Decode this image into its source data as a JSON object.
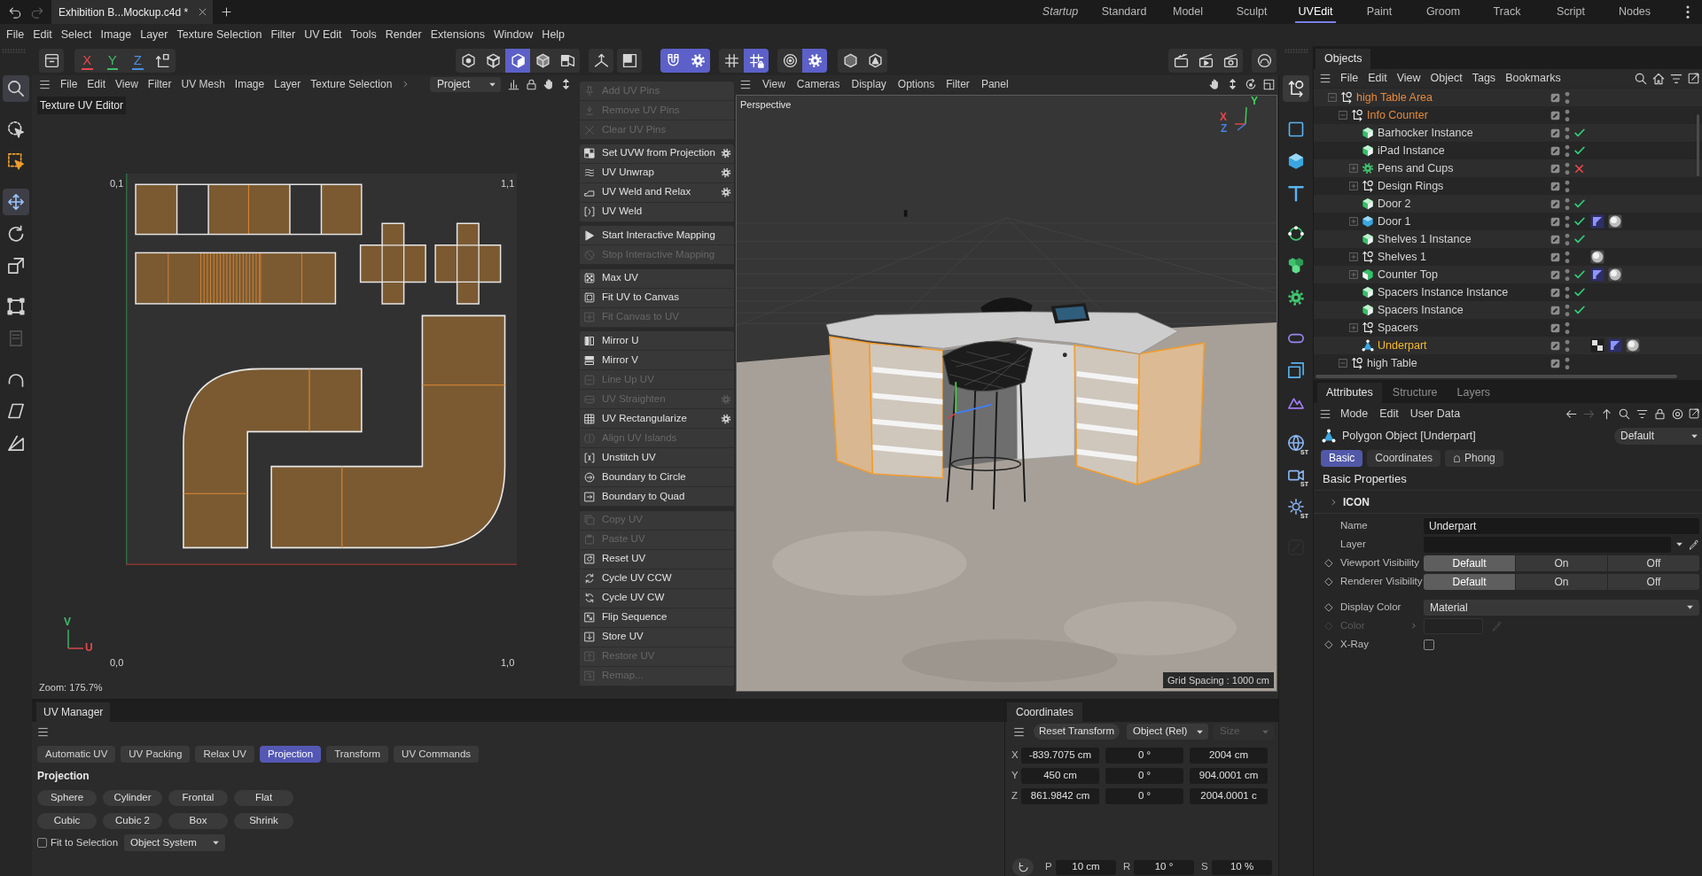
{
  "title_bar": {
    "document_tab": "Exhibition B...Mockup.c4d *",
    "layouts": [
      {
        "label": "Startup",
        "kind": "startup",
        "selected": false
      },
      {
        "label": "Standard",
        "kind": "layout",
        "selected": false
      },
      {
        "label": "Model",
        "kind": "layout",
        "selected": false
      },
      {
        "label": "Sculpt",
        "kind": "layout",
        "selected": false
      },
      {
        "label": "UVEdit",
        "kind": "layout",
        "selected": true
      },
      {
        "label": "Paint",
        "kind": "layout",
        "selected": false
      },
      {
        "label": "Groom",
        "kind": "layout",
        "selected": false
      },
      {
        "label": "Track",
        "kind": "layout",
        "selected": false
      },
      {
        "label": "Script",
        "kind": "layout",
        "selected": false
      },
      {
        "label": "Nodes",
        "kind": "layout",
        "selected": false
      }
    ]
  },
  "menu": [
    "File",
    "Edit",
    "Select",
    "Image",
    "Layer",
    "Texture Selection",
    "Filter",
    "UV Edit",
    "Tools",
    "Render",
    "Extensions",
    "Window",
    "Help"
  ],
  "toolbar": {
    "axis_locks": [
      {
        "label": "X",
        "on": true,
        "color": "#e5484d"
      },
      {
        "label": "Y",
        "on": true,
        "color": "#3dbd6b"
      },
      {
        "label": "Z",
        "on": true,
        "color": "#4a90e2"
      }
    ],
    "groups": [
      [
        {
          "active": false
        }
      ],
      [
        {
          "active": false
        },
        {
          "active": false
        },
        {
          "active": true
        },
        {
          "active": false
        },
        {
          "active": false
        }
      ],
      [
        {
          "active": false
        }
      ],
      [
        {
          "active": false
        }
      ],
      [
        {
          "active": true
        },
        {
          "active": true
        }
      ],
      [
        {
          "active": false
        },
        {
          "active": true
        }
      ],
      [
        {
          "active": false
        },
        {
          "active": true
        }
      ],
      [
        {
          "active": false
        },
        {
          "active": false
        }
      ],
      [
        {
          "active": false
        },
        {
          "active": false
        },
        {
          "active": false
        }
      ],
      [
        {
          "active": false
        }
      ]
    ]
  },
  "left_tools": [
    [
      {
        "active": true,
        "disabled": false
      }
    ],
    [
      {
        "active": false,
        "disabled": false
      },
      {
        "active": false,
        "disabled": false
      }
    ],
    [
      {
        "active": true,
        "disabled": false
      },
      {
        "active": false,
        "disabled": false
      },
      {
        "active": false,
        "disabled": false
      }
    ],
    [
      {
        "active": false,
        "disabled": false
      },
      {
        "active": false,
        "disabled": true
      }
    ],
    [
      {
        "active": false,
        "disabled": false
      },
      {
        "active": false,
        "disabled": false
      },
      {
        "active": false,
        "disabled": false
      }
    ]
  ],
  "uv_editor": {
    "menu": [
      "File",
      "Edit",
      "View",
      "Filter",
      "UV Mesh",
      "Image",
      "Layer",
      "Texture Selection"
    ],
    "mode": "Project",
    "title": "Texture UV Editor",
    "corner_labels": [
      "0,1",
      "1,1",
      "0,0",
      "1,0"
    ],
    "axis_labels": [
      {
        "label": "V",
        "color": "#3dbd6b"
      },
      {
        "label": "U",
        "color": "#e5484d"
      }
    ],
    "zoom": "Zoom: 175.7%"
  },
  "uv_commands": [
    [
      {
        "label": "Add UV Pins",
        "disabled": true,
        "options": false
      },
      {
        "label": "Remove UV Pins",
        "disabled": true,
        "options": false
      },
      {
        "label": "Clear UV Pins",
        "disabled": true,
        "options": false
      }
    ],
    [
      {
        "label": "Set UVW from Projection",
        "disabled": false,
        "options": true
      },
      {
        "label": "UV Unwrap",
        "disabled": false,
        "options": true
      },
      {
        "label": "UV Weld and Relax",
        "disabled": false,
        "options": true
      },
      {
        "label": "UV Weld",
        "disabled": false,
        "options": false
      }
    ],
    [
      {
        "label": "Start Interactive Mapping",
        "disabled": false,
        "options": false
      },
      {
        "label": "Stop Interactive Mapping",
        "disabled": true,
        "options": false
      }
    ],
    [
      {
        "label": "Max UV",
        "disabled": false,
        "options": false
      },
      {
        "label": "Fit UV to Canvas",
        "disabled": false,
        "options": false
      },
      {
        "label": "Fit Canvas to UV",
        "disabled": true,
        "options": false
      }
    ],
    [
      {
        "label": "Mirror U",
        "disabled": false,
        "options": false
      },
      {
        "label": "Mirror V",
        "disabled": false,
        "options": false
      },
      {
        "label": "Line Up UV",
        "disabled": true,
        "options": false
      },
      {
        "label": "UV Straighten",
        "disabled": true,
        "options": true
      },
      {
        "label": "UV Rectangularize",
        "disabled": false,
        "options": true
      },
      {
        "label": "Align UV Islands",
        "disabled": true,
        "options": false
      },
      {
        "label": "Unstitch UV",
        "disabled": false,
        "options": false
      },
      {
        "label": "Boundary to Circle",
        "disabled": false,
        "options": false
      },
      {
        "label": "Boundary to Quad",
        "disabled": false,
        "options": false
      }
    ],
    [
      {
        "label": "Copy UV",
        "disabled": true,
        "options": false
      },
      {
        "label": "Paste UV",
        "disabled": true,
        "options": false
      },
      {
        "label": "Reset UV",
        "disabled": false,
        "options": false
      },
      {
        "label": "Cycle UV CCW",
        "disabled": false,
        "options": false
      },
      {
        "label": "Cycle UV CW",
        "disabled": false,
        "options": false
      },
      {
        "label": "Flip Sequence",
        "disabled": false,
        "options": false
      },
      {
        "label": "Store UV",
        "disabled": false,
        "options": false
      },
      {
        "label": "Restore UV",
        "disabled": true,
        "options": false
      },
      {
        "label": "Remap...",
        "disabled": true,
        "options": false
      }
    ]
  ],
  "viewport": {
    "menu": [
      "View",
      "Cameras",
      "Display",
      "Options",
      "Filter",
      "Panel"
    ],
    "camera": "Perspective",
    "axes": [
      {
        "label": "Y",
        "color": "#3dd65a"
      },
      {
        "label": "X",
        "color": "#e5484d"
      },
      {
        "label": "Z",
        "color": "#4a7fe2"
      }
    ],
    "grid_spacing": "Grid Spacing : 1000 cm"
  },
  "uv_manager": {
    "tab": "UV Manager",
    "tabs": [
      {
        "label": "Automatic UV",
        "selected": false
      },
      {
        "label": "UV Packing",
        "selected": false
      },
      {
        "label": "Relax UV",
        "selected": false
      },
      {
        "label": "Projection",
        "selected": true
      },
      {
        "label": "Transform",
        "selected": false
      },
      {
        "label": "UV Commands",
        "selected": false
      }
    ],
    "section": "Projection",
    "buttons": [
      "Sphere",
      "Cylinder",
      "Frontal",
      "Flat",
      "Cubic",
      "Cubic 2",
      "Box",
      "Shrink"
    ],
    "fit_to_selection": {
      "label": "Fit to Selection",
      "checked": false
    },
    "system": "Object System"
  },
  "coordinates": {
    "tab": "Coordinates",
    "reset": "Reset Transform",
    "mode": "Object (Rel)",
    "size": {
      "label": "Size",
      "disabled": true
    },
    "rows": [
      {
        "axis": "X",
        "values": [
          "-839.7075 cm",
          "0 °",
          "2004 cm"
        ]
      },
      {
        "axis": "Y",
        "values": [
          "450 cm",
          "0 °",
          "904.0001 cm"
        ]
      },
      {
        "axis": "Z",
        "values": [
          "861.9842 cm",
          "0 °",
          "2004.0001 c"
        ]
      }
    ],
    "steps": [
      {
        "label": "P",
        "value": "10 cm"
      },
      {
        "label": "R",
        "value": "10 °"
      },
      {
        "label": "S",
        "value": "10 %"
      }
    ]
  },
  "right_tools": [
    [
      {
        "active": true,
        "disabled": false
      }
    ],
    [
      {
        "active": false,
        "disabled": false
      },
      {
        "active": false,
        "disabled": false
      },
      {
        "active": false,
        "disabled": false
      }
    ],
    [
      {
        "active": false,
        "disabled": false
      },
      {
        "active": false,
        "disabled": false
      },
      {
        "active": false,
        "disabled": false
      }
    ],
    [
      {
        "active": false,
        "disabled": false
      },
      {
        "active": false,
        "disabled": false
      },
      {
        "active": false,
        "disabled": false
      }
    ],
    [
      {
        "active": false,
        "disabled": false,
        "badge": "ST"
      },
      {
        "active": false,
        "disabled": false,
        "badge": "ST"
      },
      {
        "active": false,
        "disabled": false,
        "badge": "ST"
      }
    ],
    [
      {
        "active": false,
        "disabled": true
      }
    ]
  ],
  "objects": {
    "tab": "Objects",
    "menu": [
      "File",
      "Edit",
      "View",
      "Object",
      "Tags",
      "Bookmarks"
    ],
    "tree": [
      {
        "name": "high Table Area",
        "kind": "null",
        "selected": false,
        "expanded": true,
        "children": [
          {
            "name": "Info Counter",
            "kind": "null",
            "selected": false,
            "expanded": true,
            "children": [
              {
                "name": "Barhocker Instance",
                "kind": "instance",
                "selected": false,
                "enabled": true
              },
              {
                "name": "iPad Instance",
                "kind": "instance",
                "selected": false,
                "enabled": true
              },
              {
                "name": "Pens and Cups",
                "kind": "generator",
                "selected": false,
                "expanded": false,
                "enabled": false
              },
              {
                "name": "Design Rings",
                "kind": "null",
                "selected": false,
                "expanded": false
              },
              {
                "name": "Door 2",
                "kind": "instance",
                "selected": false,
                "enabled": true
              },
              {
                "name": "Door 1",
                "kind": "primitive",
                "selected": false,
                "expanded": false,
                "enabled": true,
                "tags": [
                  {
                    "kind": "phong"
                  },
                  {
                    "kind": "material"
                  }
                ]
              },
              {
                "name": "Shelves 1 Instance",
                "kind": "instance",
                "selected": false,
                "enabled": true
              },
              {
                "name": "Shelves 1",
                "kind": "null",
                "selected": false,
                "expanded": false,
                "tags": [
                  {
                    "kind": "material"
                  }
                ]
              },
              {
                "name": "Counter Top",
                "kind": "extrude",
                "selected": false,
                "expanded": false,
                "enabled": true,
                "tags": [
                  {
                    "kind": "phong"
                  },
                  {
                    "kind": "material"
                  }
                ]
              },
              {
                "name": "Spacers Instance Instance",
                "kind": "instance",
                "selected": false,
                "enabled": true
              },
              {
                "name": "Spacers Instance",
                "kind": "instance",
                "selected": false,
                "enabled": true
              },
              {
                "name": "Spacers",
                "kind": "null",
                "selected": false,
                "expanded": false
              },
              {
                "name": "Underpart",
                "kind": "polygon",
                "selected": true,
                "tags": [
                  {
                    "kind": "uvw"
                  },
                  {
                    "kind": "phong"
                  },
                  {
                    "kind": "material"
                  }
                ]
              }
            ]
          },
          {
            "name": "high Table",
            "kind": "null",
            "selected": false,
            "expanded": true
          }
        ]
      }
    ]
  },
  "attributes": {
    "tabs": [
      {
        "label": "Attributes",
        "selected": true
      },
      {
        "label": "Structure",
        "selected": false
      },
      {
        "label": "Layers",
        "selected": false
      }
    ],
    "menu": [
      "Mode",
      "Edit",
      "User Data"
    ],
    "object_title": "Polygon Object [Underpart]",
    "preset": "Default",
    "subtabs": [
      {
        "label": "Basic",
        "selected": true
      },
      {
        "label": "Coordinates",
        "selected": false
      },
      {
        "label": "Phong",
        "selected": false
      }
    ],
    "section": "Basic Properties",
    "group": {
      "label": "ICON",
      "expanded": false
    },
    "fields": [
      {
        "kind": "text",
        "label": "Name",
        "value": "Underpart",
        "animatable": false,
        "disabled": false
      },
      {
        "kind": "dropdown",
        "label": "Layer",
        "animatable": false,
        "disabled": false
      },
      {
        "kind": "segmented",
        "label": "Viewport Visibility",
        "animatable": true,
        "disabled": false,
        "options": [
          {
            "label": "Default",
            "selected": true
          },
          {
            "label": "On",
            "selected": false
          },
          {
            "label": "Off",
            "selected": false
          }
        ]
      },
      {
        "kind": "segmented",
        "label": "Renderer Visibility",
        "animatable": true,
        "disabled": false,
        "options": [
          {
            "label": "Default",
            "selected": true
          },
          {
            "label": "On",
            "selected": false
          },
          {
            "label": "Off",
            "selected": false
          }
        ]
      },
      {
        "kind": "select",
        "label": "Display Color",
        "value": "Material",
        "animatable": true,
        "disabled": false
      },
      {
        "kind": "color",
        "label": "Color",
        "animatable": true,
        "disabled": true
      },
      {
        "kind": "checkbox",
        "label": "X-Ray",
        "checked": false,
        "animatable": true,
        "disabled": false
      }
    ]
  }
}
